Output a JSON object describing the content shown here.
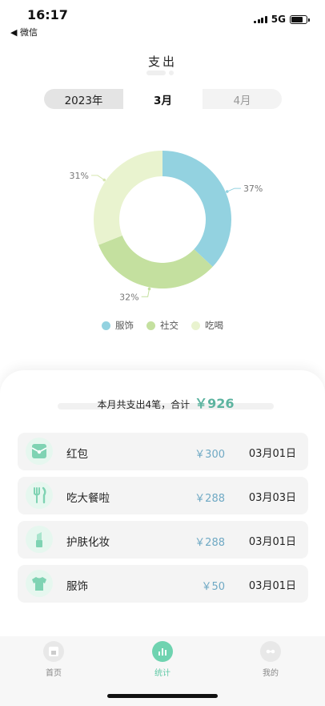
{
  "status": {
    "time": "16:17",
    "back_label": "◀ 微信",
    "network": "5G"
  },
  "page": {
    "title": "支出"
  },
  "segment": {
    "year": "2023年",
    "current_month": "3月",
    "next_month": "4月"
  },
  "colors": {
    "clothing": "#93d2e0",
    "social": "#c4e09f",
    "food": "#e9f3cf",
    "accent": "#5cb39f",
    "amount": "#6fa9c4"
  },
  "chart_data": {
    "type": "pie",
    "style": "donut",
    "categories": [
      "服饰",
      "社交",
      "吃喝"
    ],
    "values": [
      37,
      32,
      31
    ],
    "labels": [
      "37%",
      "32%",
      "31%"
    ],
    "legend": "bottom"
  },
  "summary": {
    "text": "本月共支出4笔，合计",
    "amount": "￥926"
  },
  "records": [
    {
      "name": "红包",
      "amount": "￥300",
      "date": "03月01日",
      "icon": "red-envelope-icon"
    },
    {
      "name": "吃大餐啦",
      "amount": "￥288",
      "date": "03月03日",
      "icon": "fork-knife-icon"
    },
    {
      "name": "护肤化妆",
      "amount": "￥288",
      "date": "03月01日",
      "icon": "lipstick-icon"
    },
    {
      "name": "服饰",
      "amount": "￥50",
      "date": "03月01日",
      "icon": "tshirt-icon"
    }
  ],
  "tabs": [
    {
      "label": "首页",
      "icon": "home-icon"
    },
    {
      "label": "统计",
      "icon": "chart-icon"
    },
    {
      "label": "我的",
      "icon": "profile-icon"
    }
  ]
}
